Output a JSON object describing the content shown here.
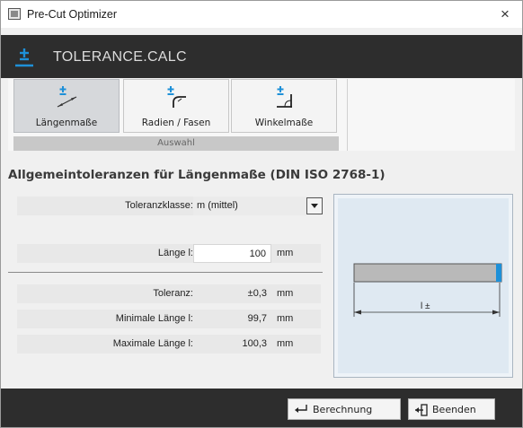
{
  "window": {
    "title": "Pre-Cut Optimizer",
    "close": "×"
  },
  "header": {
    "title": "TOLERANCE.CALC"
  },
  "ribbon": {
    "buttons": [
      {
        "label": "Längenmaße",
        "active": true
      },
      {
        "label": "Radien / Fasen",
        "active": false
      },
      {
        "label": "Winkelmaße",
        "active": false
      }
    ],
    "group_label": "Auswahl"
  },
  "section": {
    "heading": "Allgemeintoleranzen für Längenmaße (DIN ISO 2768-1)"
  },
  "form": {
    "toleranzklasse": {
      "label": "Toleranzklasse:",
      "value": "m (mittel)"
    },
    "laenge": {
      "label": "Länge l:",
      "value": "100",
      "unit": "mm"
    },
    "toleranz": {
      "label": "Toleranz:",
      "value": "±0,3",
      "unit": "mm"
    },
    "min_laenge": {
      "label": "Minimale Länge l:",
      "value": "99,7",
      "unit": "mm"
    },
    "max_laenge": {
      "label": "Maximale Länge l:",
      "value": "100,3",
      "unit": "mm"
    }
  },
  "preview": {
    "dimension_label": "l ±"
  },
  "footer": {
    "calc_label": "Berechnung",
    "exit_label": "Beenden"
  },
  "colors": {
    "accent": "#1e90d8",
    "header_bg": "#2d2d2d",
    "active_button": "#d6d8db"
  }
}
